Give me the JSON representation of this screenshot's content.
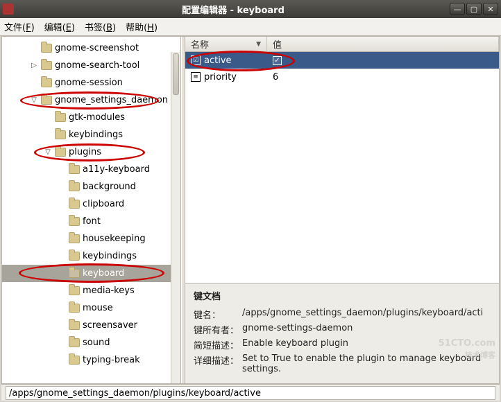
{
  "titlebar": {
    "title": "配置编辑器 - keyboard"
  },
  "menubar": {
    "file": "文件(",
    "file_key": "F",
    "file_end": ")",
    "edit": "编辑(",
    "edit_key": "E",
    "edit_end": ")",
    "bookmarks": "书签(",
    "bookmarks_key": "B",
    "bookmarks_end": ")",
    "help": "帮助(",
    "help_key": "H",
    "help_end": ")"
  },
  "tree": {
    "items": [
      {
        "id": "gnome-screenshot",
        "label": "gnome-screenshot",
        "indent": 1,
        "exp": ""
      },
      {
        "id": "gnome-search-tool",
        "label": "gnome-search-tool",
        "indent": 1,
        "exp": "▷"
      },
      {
        "id": "gnome-session",
        "label": "gnome-session",
        "indent": 1,
        "exp": ""
      },
      {
        "id": "gnome-settings-daemon",
        "label": "gnome_settings_daemon",
        "indent": 1,
        "exp": "▽",
        "annot": true,
        "aw": 200,
        "ah": 26,
        "al": 26,
        "at": 0
      },
      {
        "id": "gtk-modules",
        "label": "gtk-modules",
        "indent": 2,
        "exp": ""
      },
      {
        "id": "keybindings",
        "label": "keybindings",
        "indent": 2,
        "exp": ""
      },
      {
        "id": "plugins",
        "label": "plugins",
        "indent": 2,
        "exp": "▽",
        "annot": true,
        "aw": 160,
        "ah": 26,
        "al": 46,
        "at": 0
      },
      {
        "id": "a11y-keyboard",
        "label": "a11y-keyboard",
        "indent": 3,
        "exp": ""
      },
      {
        "id": "background",
        "label": "background",
        "indent": 3,
        "exp": ""
      },
      {
        "id": "clipboard",
        "label": "clipboard",
        "indent": 3,
        "exp": ""
      },
      {
        "id": "font",
        "label": "font",
        "indent": 3,
        "exp": ""
      },
      {
        "id": "housekeeping",
        "label": "housekeeping",
        "indent": 3,
        "exp": ""
      },
      {
        "id": "keybindings2",
        "label": "keybindings",
        "indent": 3,
        "exp": ""
      },
      {
        "id": "keyboard",
        "label": "keyboard",
        "indent": 3,
        "exp": "",
        "selected": true,
        "annot": true,
        "aw": 210,
        "ah": 28,
        "al": 24,
        "at": -2
      },
      {
        "id": "media-keys",
        "label": "media-keys",
        "indent": 3,
        "exp": ""
      },
      {
        "id": "mouse",
        "label": "mouse",
        "indent": 3,
        "exp": ""
      },
      {
        "id": "screensaver",
        "label": "screensaver",
        "indent": 3,
        "exp": ""
      },
      {
        "id": "sound",
        "label": "sound",
        "indent": 3,
        "exp": ""
      },
      {
        "id": "typing-break",
        "label": "typing-break",
        "indent": 3,
        "exp": ""
      }
    ]
  },
  "table": {
    "col_name": "名称",
    "col_value": "值",
    "rows": [
      {
        "key": "active",
        "value_checked": true,
        "selected": true
      },
      {
        "key": "priority",
        "value": "6"
      }
    ]
  },
  "doc": {
    "heading": "键文档",
    "keyname_label": "键名：",
    "keyname": "/apps/gnome_settings_daemon/plugins/keyboard/acti",
    "owner_label": "键所有者：",
    "owner": "gnome-settings-daemon",
    "short_label": "简短描述：",
    "short": "Enable keyboard plugin",
    "long_label": "详细描述：",
    "long": "Set to True to enable the plugin to manage keyboard settings."
  },
  "statusbar": {
    "path": "/apps/gnome_settings_daemon/plugins/keyboard/active"
  },
  "watermark": {
    "main": "51CTO.com",
    "sub": "技术博客"
  }
}
